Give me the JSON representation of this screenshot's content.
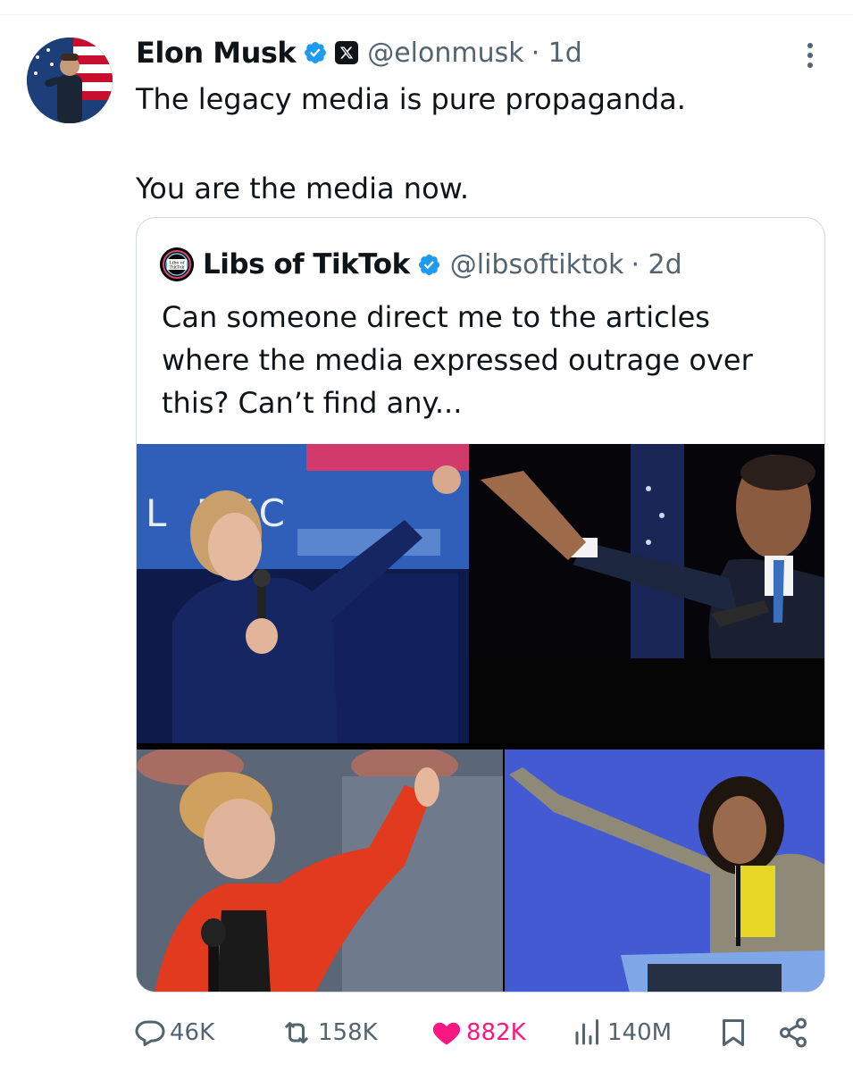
{
  "tweet": {
    "author_name": "Elon Musk",
    "handle": "@elonmusk",
    "time": "· 1d",
    "text_line1": "The legacy media is pure propaganda.",
    "text_line2": "You are the media now."
  },
  "quoted": {
    "author_name": "Libs of TikTok",
    "handle": "@libsoftiktok",
    "time": "· 2d",
    "text": "Can someone direct me to the articles where the media expressed outrage over this? Can’t find any...",
    "avatar_text": "Libs of TikTok",
    "image_text": "L RYC"
  },
  "actions": {
    "replies": "46K",
    "reposts": "158K",
    "likes": "882K",
    "views": "140M"
  },
  "colors": {
    "verified": "#1d9bf0",
    "like": "#f91880",
    "secondary_text": "#536471"
  }
}
